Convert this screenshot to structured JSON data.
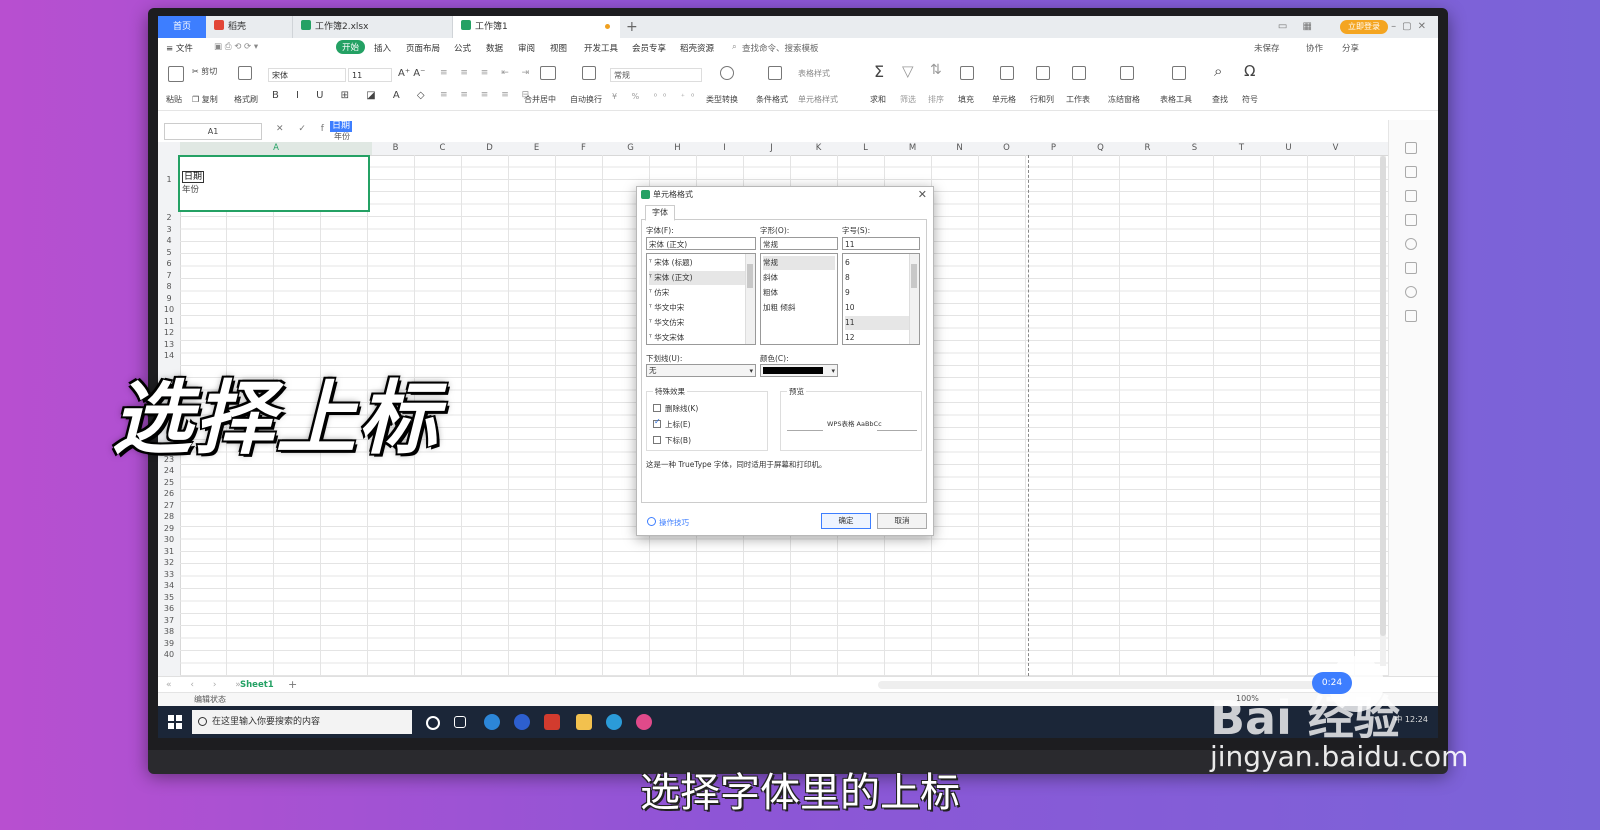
{
  "tabs": {
    "home": "首页",
    "docer": "稻壳",
    "file1": "工作簿2.xlsx",
    "file2": "工作簿1",
    "plus": "+",
    "login": "立即登录"
  },
  "menu": {
    "file": "≡ 文件",
    "items": [
      "开始",
      "插入",
      "页面布局",
      "公式",
      "数据",
      "审阅",
      "视图",
      "开发工具",
      "会员专享",
      "稻壳资源"
    ],
    "search": "查找命令、搜索模板",
    "unsaved": "未保存",
    "collab": "协作",
    "share": "分享"
  },
  "toolbar": {
    "paste": "粘贴",
    "cut": "剪切",
    "copy": "复制",
    "format_painter": "格式刷",
    "font": "宋体",
    "size": "11",
    "merge": "合并居中",
    "wrap": "自动换行",
    "number_format": "常规",
    "type_convert": "类型转换",
    "cond_format": "条件格式",
    "table_style": "表格样式",
    "cell_style": "单元格样式",
    "sum": "求和",
    "filter": "筛选",
    "sort": "排序",
    "fill": "填充",
    "cell": "单元格",
    "rowcol": "行和列",
    "worksheet": "工作表",
    "freeze": "冻结窗格",
    "table_tools": "表格工具",
    "find": "查找",
    "symbol": "符号"
  },
  "formula": {
    "namebox": "A1",
    "icons": "✕ ✓ fx",
    "line1": "日期",
    "line2": "年份"
  },
  "grid": {
    "columns": [
      "A",
      "B",
      "C",
      "D",
      "E",
      "F",
      "G",
      "H",
      "I",
      "J",
      "K",
      "L",
      "M",
      "N",
      "O",
      "P",
      "Q",
      "R",
      "S",
      "T",
      "U",
      "V"
    ],
    "rows": [
      "1",
      "2",
      "3",
      "4",
      "5",
      "6",
      "7",
      "8",
      "9",
      "10",
      "11",
      "12",
      "13",
      "14",
      "22",
      "23",
      "24",
      "25",
      "26",
      "27",
      "28",
      "29",
      "30",
      "31",
      "32",
      "33",
      "34",
      "35",
      "36",
      "37",
      "38",
      "39",
      "40"
    ],
    "a1_line1": "日期",
    "a1_line2": "年份"
  },
  "sheet": {
    "tab": "Sheet1",
    "status": "编辑状态",
    "zoom": "100%"
  },
  "taskbar": {
    "search": "在这里输入你要搜索的内容",
    "tray": "中  12:24"
  },
  "dialog": {
    "title": "单元格格式",
    "tab": "字体",
    "font_label": "字体(F):",
    "font_value": "宋体 (正文)",
    "fonts": [
      "宋体 (标题)",
      "宋体 (正文)",
      "仿宋",
      "华文中宋",
      "华文仿宋",
      "华文宋体"
    ],
    "style_label": "字形(O):",
    "style_value": "常规",
    "styles": [
      "常规",
      "斜体",
      "粗体",
      "加粗 倾斜"
    ],
    "size_label": "字号(S):",
    "size_value": "11",
    "sizes": [
      "6",
      "8",
      "9",
      "10",
      "11",
      "12"
    ],
    "underline_label": "下划线(U):",
    "underline_value": "无",
    "color_label": "颜色(C):",
    "effects_label": "特殊效果",
    "strike": "删除线(K)",
    "superscript": "上标(E)",
    "subscript": "下标(B)",
    "preview_label": "预览",
    "preview_text": "WPS表格  AaBbCc",
    "note": "这是一种 TrueType 字体，同时适用于屏幕和打印机。",
    "tips": "操作技巧",
    "ok": "确定",
    "cancel": "取消"
  },
  "overlay": {
    "caption": "选择上标",
    "subtitle": "选择字体里的上标",
    "watermark": "Bai 经验",
    "watermark_url": "jingyan.baidu.com",
    "bubble": "0:24"
  }
}
